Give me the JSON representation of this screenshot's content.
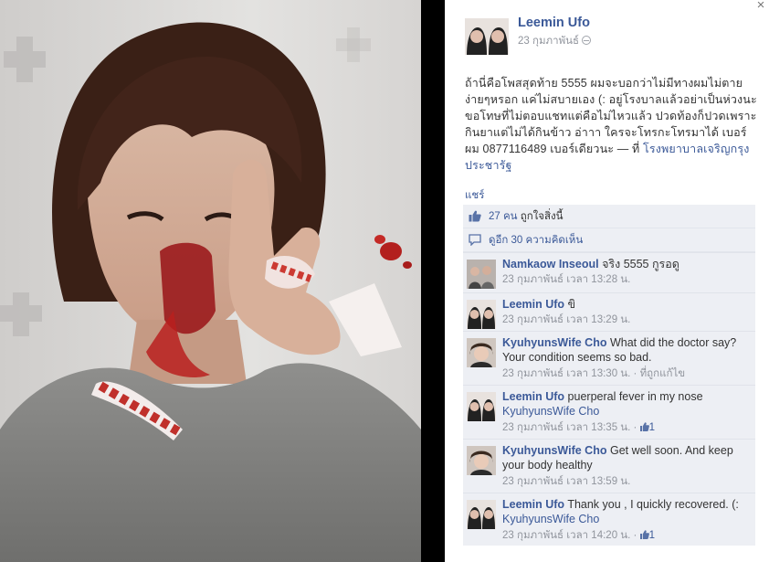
{
  "post": {
    "author": "Leemin Ufo",
    "date": "23 กุมภาพันธ์",
    "text": "ถ้านี่คือโพสสุดท้าย 5555 ผมจะบอกว่าไม่มีทางผมไม่ตายง่ายๆหรอก แค่ไม่สบายเอง (: อยู่โรงบาลแล้วอย่าเป็นห่วงนะ ขอโทษที่ไม่ตอบแชทแต่คือไม่ไหวแล้ว ปวดท้องก็ปวดเพราะกินยาแต่ไม่ได้กินข้าว อ่าาา ใครจะโทรกะโทรมาได้ เบอร์ผม 0877116489 เบอร์เดียวนะ —",
    "at_prefix": "ที่",
    "location": "โรงพยาบาลเจริญกรุงประชารัฐ",
    "share_label": "แชร์"
  },
  "ufi": {
    "likes_count": "27 คน",
    "likes_suffix": "ถูกใจสิ่งนี้",
    "view_more": "ดูอีก 30 ความคิดเห็น"
  },
  "comments": [
    {
      "name": "Namkaow Inseoul",
      "text": "จริง 5555 กูรอดู",
      "time": "23 กุมภาพันธ์ เวลา 13:28 น.",
      "avatar": "group-photo"
    },
    {
      "name": "Leemin Ufo",
      "text": "ขิ",
      "time": "23 กุมภาพันธ์ เวลา 13:29 น.",
      "avatar": "leemin"
    },
    {
      "name": "KyuhyunsWife Cho",
      "text": "What did the doctor say? Your condition seems so bad.",
      "time": "23 กุมภาพันธ์ เวลา 13:30 น.",
      "edited": "ที่ถูกแก้ไข",
      "avatar": "kyu"
    },
    {
      "name": "Leemin Ufo",
      "text": "puerperal fever in my nose",
      "tag": "KyuhyunsWife Cho",
      "time": "23 กุมภาพันธ์ เวลา 13:35 น.",
      "likes": "1",
      "avatar": "leemin"
    },
    {
      "name": "KyuhyunsWife Cho",
      "text": "Get well soon. And keep your body healthy",
      "time": "23 กุมภาพันธ์ เวลา 13:59 น.",
      "avatar": "kyu"
    },
    {
      "name": "Leemin Ufo",
      "text": "Thank you , I quickly recovered. (:",
      "tag": "KyuhyunsWife Cho",
      "time": "23 กุมภาพันธ์ เวลา 14:20 น.",
      "likes": "1",
      "avatar": "leemin"
    }
  ],
  "close_label": "×",
  "colors": {
    "link": "#3b5998",
    "meta": "#90949c",
    "ufi_bg": "#edeff4",
    "backdrop": "#000000"
  },
  "icons": [
    "close-icon",
    "globe-icon",
    "like-icon",
    "comment-bubble-icon",
    "small-like-icon"
  ]
}
